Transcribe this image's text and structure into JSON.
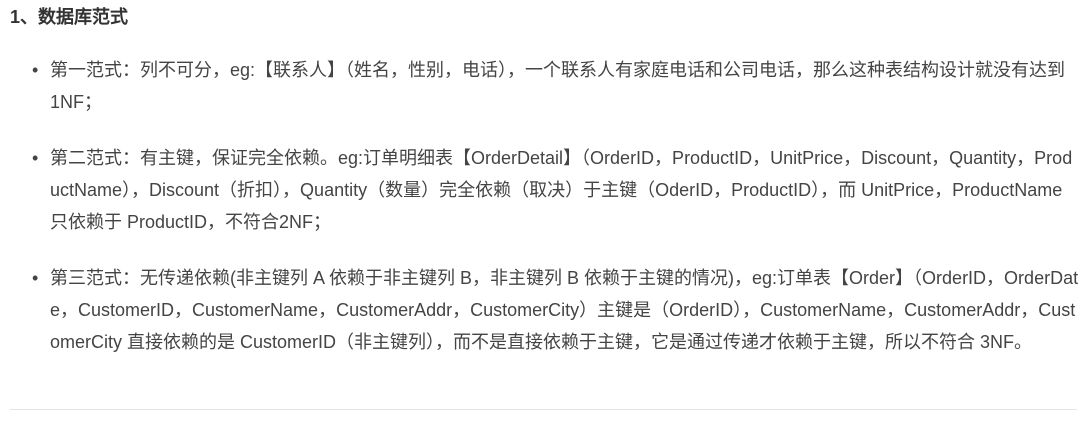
{
  "heading": "1、数据库范式",
  "bullet_glyph": "•",
  "items": [
    {
      "text": "第一范式：列不可分，eg:【联系人】（姓名，性别，电话），一个联系人有家庭电话和公司电话，那么这种表结构设计就没有达到 1NF；"
    },
    {
      "text": "第二范式：有主键，保证完全依赖。eg:订单明细表【OrderDetail】（OrderID，ProductID，UnitPrice，Discount，Quantity，ProductName），Discount（折扣），Quantity（数量）完全依赖（取决）于主键（OderID，ProductID），而 UnitPrice，ProductName 只依赖于 ProductID，不符合2NF；"
    },
    {
      "text": "第三范式：无传递依赖(非主键列 A 依赖于非主键列 B，非主键列 B 依赖于主键的情况)，eg:订单表【Order】（OrderID，OrderDate，CustomerID，CustomerName，CustomerAddr，CustomerCity）主键是（OrderID），CustomerName，CustomerAddr，CustomerCity 直接依赖的是 CustomerID（非主键列），而不是直接依赖于主键，它是通过传递才依赖于主键，所以不符合 3NF。"
    }
  ]
}
